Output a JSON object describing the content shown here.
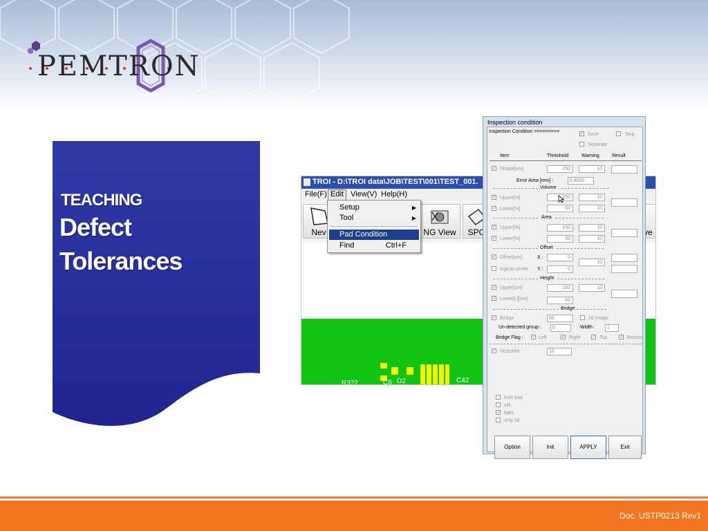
{
  "logo": {
    "text": "PEMTRON"
  },
  "title": {
    "small": "TEACHING",
    "line1": "Defect",
    "line2": "Tolerances"
  },
  "app": {
    "title": "TROI - D:\\TROI data\\JOB\\TEST\\001\\TEST_001.",
    "menu": {
      "file": "File(F)",
      "edit": "Edit",
      "view": "View(V)",
      "help": "Help(H)"
    },
    "toolbar": {
      "new": "Nev",
      "ngview": "NG View",
      "spc": "SPC",
      "save": "ve"
    },
    "edit_menu": {
      "setup": "Setup",
      "tool": "Tool",
      "pad_condition": "Pad Condition",
      "find": "Find",
      "find_shortcut": "Ctrl+F"
    },
    "pcb_labels": {
      "r": "R3?2",
      "c6": "C6",
      "d2": "D2",
      "c42": "C42"
    },
    "colors": {
      "pcb": "#11c411",
      "pad": "#f4f200",
      "titlebar": "#2b4fae",
      "highlight": "#1d3f8f"
    }
  },
  "dialog": {
    "title": "Inspection condition",
    "header": "Inspection Condition =========",
    "save": "Save",
    "skip": "Skip",
    "separate": "Separate",
    "cols": {
      "item": "Item",
      "threshold": "Threshold",
      "warning": "Warning",
      "result": "Result"
    },
    "shape": {
      "label": "Shape[um]",
      "threshold": "250",
      "warning": "10"
    },
    "error_area": {
      "label": "Error Area [mm] :",
      "value": "0.4000"
    },
    "volume_header": "Volume",
    "vol_upper": {
      "label": "Upper[%]",
      "threshold": "150",
      "warning": "10"
    },
    "vol_lower": {
      "label": "Lower[%]",
      "threshold": "50",
      "warning": "10"
    },
    "area_header": "Area",
    "area_upper": {
      "label": "Upper[%]",
      "threshold": "150",
      "warning": "10"
    },
    "area_lower": {
      "label": "Lower[%]",
      "threshold": "50",
      "warning": "10"
    },
    "offset_header": "Offset",
    "offset": {
      "label": "Offset[um]",
      "x_label": "X :",
      "x": "0",
      "logical": "logical center",
      "y_label": "Y :",
      "y": "0",
      "warning": "10"
    },
    "height_header": "Height",
    "h_upper": {
      "label": "Upper[um]",
      "threshold": "180",
      "warning": "10"
    },
    "h_lower": {
      "label": "Lower[L][um]",
      "threshold": "60"
    },
    "bridge_header": "Bridge",
    "bridge": {
      "label": "Bridge",
      "value": "60",
      "image2d": "2d image",
      "undetected_label": "Un-detected group :",
      "undetected": "0",
      "width_label": "Width :",
      "width": "1",
      "flag_label": "Bridge  Flag :",
      "left": "Left",
      "right": "Right",
      "top": "Top",
      "bottom": "Bottom"
    },
    "nosolder": {
      "label": "NoSolder",
      "value": "10"
    },
    "options": {
      "hole_pad": "hole pad",
      "silk": "silk",
      "bare": "bare",
      "only3d": "only 3d"
    },
    "buttons": {
      "option": "Option",
      "init": "Init",
      "apply": "APPLY",
      "exit": "Exit"
    }
  },
  "footer": {
    "doc": "Doc. USTP0213 Rev1"
  },
  "theme": {
    "panel_blue": "#2a2fa0",
    "footer_orange": "#f27622"
  }
}
